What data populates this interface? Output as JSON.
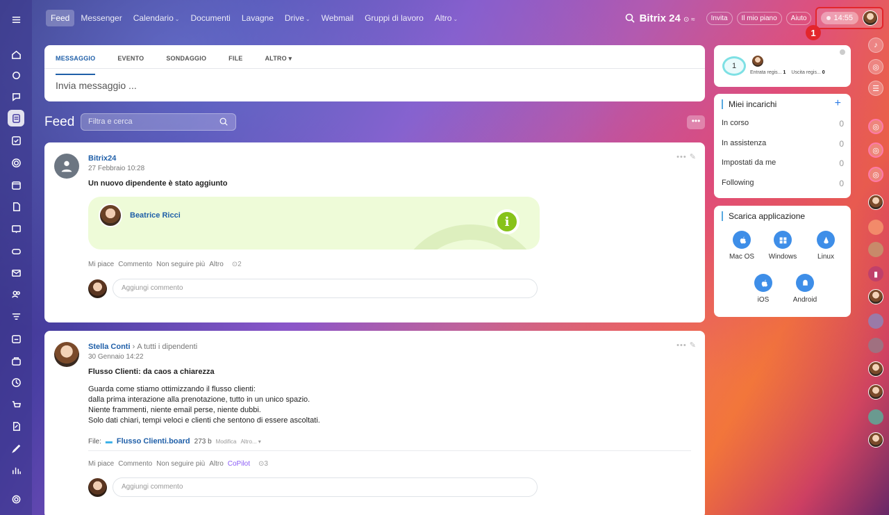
{
  "topnav": {
    "items": [
      {
        "label": "Feed",
        "active": true,
        "caret": false
      },
      {
        "label": "Messenger",
        "active": false,
        "caret": false
      },
      {
        "label": "Calendario",
        "active": false,
        "caret": true
      },
      {
        "label": "Documenti",
        "active": false,
        "caret": false
      },
      {
        "label": "Lavagne",
        "active": false,
        "caret": false
      },
      {
        "label": "Drive",
        "active": false,
        "caret": true
      },
      {
        "label": "Webmail",
        "active": false,
        "caret": false
      },
      {
        "label": "Gruppi di lavoro",
        "active": false,
        "caret": false
      },
      {
        "label": "Altro",
        "active": false,
        "caret": true
      }
    ],
    "caret_glyph": "⌄",
    "brand": "Bitrix 24",
    "brand_suffix": "⊙ ≈",
    "invite": "Invita",
    "plan": "Il mio piano",
    "help": "Aiuto",
    "clock": "14:55",
    "callout_number": "1"
  },
  "composer": {
    "tabs": [
      "MESSAGGIO",
      "EVENTO",
      "SONDAGGIO",
      "FILE",
      "ALTRO ▾"
    ],
    "placeholder": "Invia messaggio ..."
  },
  "feed": {
    "title": "Feed",
    "filter_placeholder": "Filtra e cerca",
    "more": "•••"
  },
  "post1": {
    "author": "Bitrix24",
    "date": "27 Febbraio 10:28",
    "title": "Un nuovo dipendente è stato aggiunto",
    "employee": "Beatrice Ricci",
    "info_glyph": "i",
    "actions": [
      "Mi piace",
      "Commento",
      "Non seguire più",
      "Altro"
    ],
    "views": "⊙2",
    "comment_placeholder": "Aggiungi commento"
  },
  "post2": {
    "author": "Stella Conti",
    "recipient": "A tutti i dipendenti",
    "date": "30 Gennaio 14:22",
    "title": "Flusso Clienti: da caos a chiarezza",
    "body": [
      "Guarda come stiamo ottimizzando il flusso clienti:",
      "dalla prima interazione alla prenotazione, tutto in un unico spazio.",
      "Niente frammenti, niente email perse, niente dubbi.",
      "Solo dati chiari, tempi veloci e clienti che sentono di essere ascoltati."
    ],
    "file_label": "File:",
    "file_name": "Flusso Clienti.board",
    "file_size": "273 b",
    "file_edit": "Modifica",
    "file_more": "Altro... ▾",
    "actions": [
      "Mi piace",
      "Commento",
      "Non seguire più",
      "Altro"
    ],
    "copilot": "CoPilot",
    "views": "⊙3",
    "comment_placeholder": "Aggiungi commento"
  },
  "timewidget": {
    "count": "1",
    "entrata_label": "Entrata regis...",
    "entrata_value": "1",
    "uscita_label": "Uscita regis...",
    "uscita_value": "0"
  },
  "tasks": {
    "title": "Miei incarichi",
    "plus": "+",
    "rows": [
      {
        "label": "In corso",
        "count": "0"
      },
      {
        "label": "In assistenza",
        "count": "0"
      },
      {
        "label": "Impostati da me",
        "count": "0"
      },
      {
        "label": "Following",
        "count": "0"
      }
    ]
  },
  "apps": {
    "title": "Scarica applicazione",
    "items": [
      {
        "label": "Mac OS",
        "icon": "apple-icon"
      },
      {
        "label": "Windows",
        "icon": "windows-icon"
      },
      {
        "label": "Linux",
        "icon": "linux-icon"
      },
      {
        "label": "iOS",
        "icon": "apple-icon"
      },
      {
        "label": "Android",
        "icon": "android-icon"
      }
    ]
  },
  "colors": {
    "accent_blue": "#1f5fa8",
    "highlight_red": "#e3262c",
    "welcome_green": "#eefbd8",
    "info_green": "#87c21a",
    "copilot_purple": "#8b5cf6"
  }
}
